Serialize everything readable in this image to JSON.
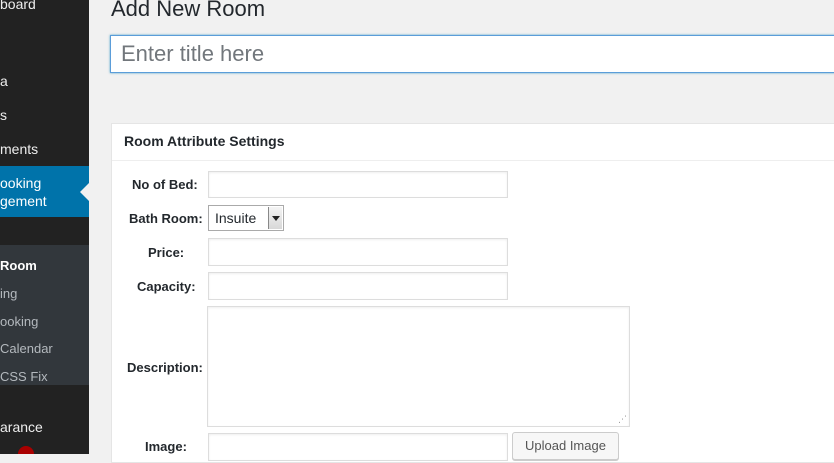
{
  "sidebar": {
    "items": [
      {
        "label": "board"
      },
      {
        "label": "a"
      },
      {
        "label": "s"
      },
      {
        "label": "ments"
      },
      {
        "label": "arance"
      }
    ],
    "active": {
      "label": "ooking\ngement"
    },
    "submenu": [
      {
        "label": "Room"
      },
      {
        "label": "ing"
      },
      {
        "label": "ooking"
      },
      {
        "label": "Calendar"
      },
      {
        "label": "CSS Fix"
      }
    ]
  },
  "main": {
    "page_title": "Add New Room",
    "title_placeholder": "Enter title here",
    "box_title": "Room Attribute Settings",
    "fields": {
      "bed_label": "No of Bed:",
      "bath_label": "Bath Room:",
      "bath_value": "Insuite",
      "price_label": "Price:",
      "capacity_label": "Capacity:",
      "description_label": "Description:",
      "image_label": "Image:",
      "upload_label": "Upload Image"
    }
  }
}
